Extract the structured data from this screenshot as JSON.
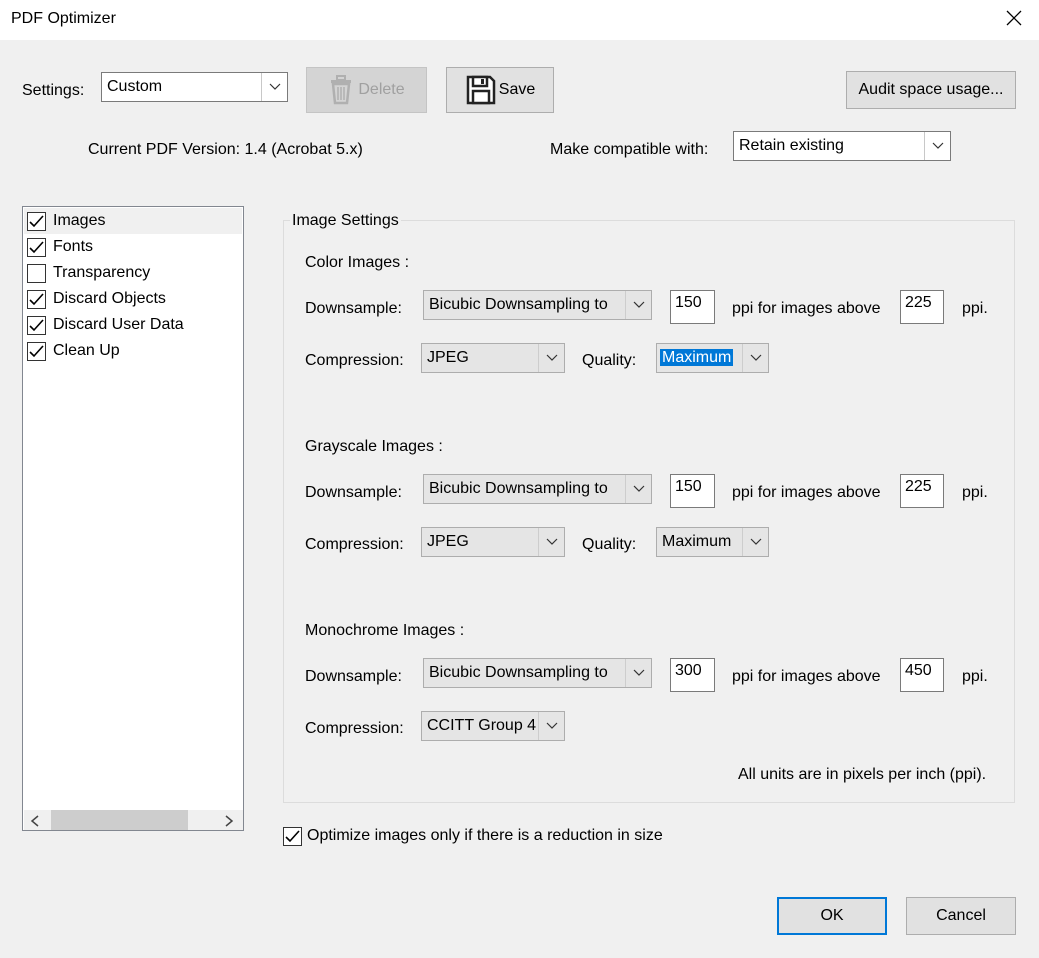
{
  "window": {
    "title": "PDF Optimizer",
    "close_icon": "close-icon"
  },
  "toolbar": {
    "settings_label": "Settings:",
    "settings_value": "Custom",
    "delete_label": "Delete",
    "save_label": "Save",
    "audit_label": "Audit space usage..."
  },
  "version": {
    "current_label": "Current PDF Version: 1.4 (Acrobat 5.x)",
    "compat_label": "Make compatible with:",
    "compat_value": "Retain existing"
  },
  "panels": [
    {
      "label": "Images",
      "checked": true
    },
    {
      "label": "Fonts",
      "checked": true
    },
    {
      "label": "Transparency",
      "checked": false
    },
    {
      "label": "Discard Objects",
      "checked": true
    },
    {
      "label": "Discard User Data",
      "checked": true
    },
    {
      "label": "Clean Up",
      "checked": true
    }
  ],
  "image_settings": {
    "group_title": "Image Settings",
    "downsample_label": "Downsample:",
    "compression_label": "Compression:",
    "quality_label": "Quality:",
    "ppi_above_label": "ppi for images above",
    "ppi_label": "ppi.",
    "color": {
      "title": "Color Images :",
      "downsample": "Bicubic Downsampling to",
      "ppi": "150",
      "above": "225",
      "compression": "JPEG",
      "quality": "Maximum"
    },
    "grayscale": {
      "title": "Grayscale Images :",
      "downsample": "Bicubic Downsampling to",
      "ppi": "150",
      "above": "225",
      "compression": "JPEG",
      "quality": "Maximum"
    },
    "mono": {
      "title": "Monochrome Images :",
      "downsample": "Bicubic Downsampling to",
      "ppi": "300",
      "above": "450",
      "compression": "CCITT Group 4"
    },
    "units_note": "All units are in pixels per inch (ppi)."
  },
  "optimize_only_label": "Optimize images only if there is a reduction in size",
  "optimize_only_checked": true,
  "footer": {
    "ok_label": "OK",
    "cancel_label": "Cancel"
  },
  "colors": {
    "accent": "#0078d7",
    "background": "#f0f0f0"
  }
}
